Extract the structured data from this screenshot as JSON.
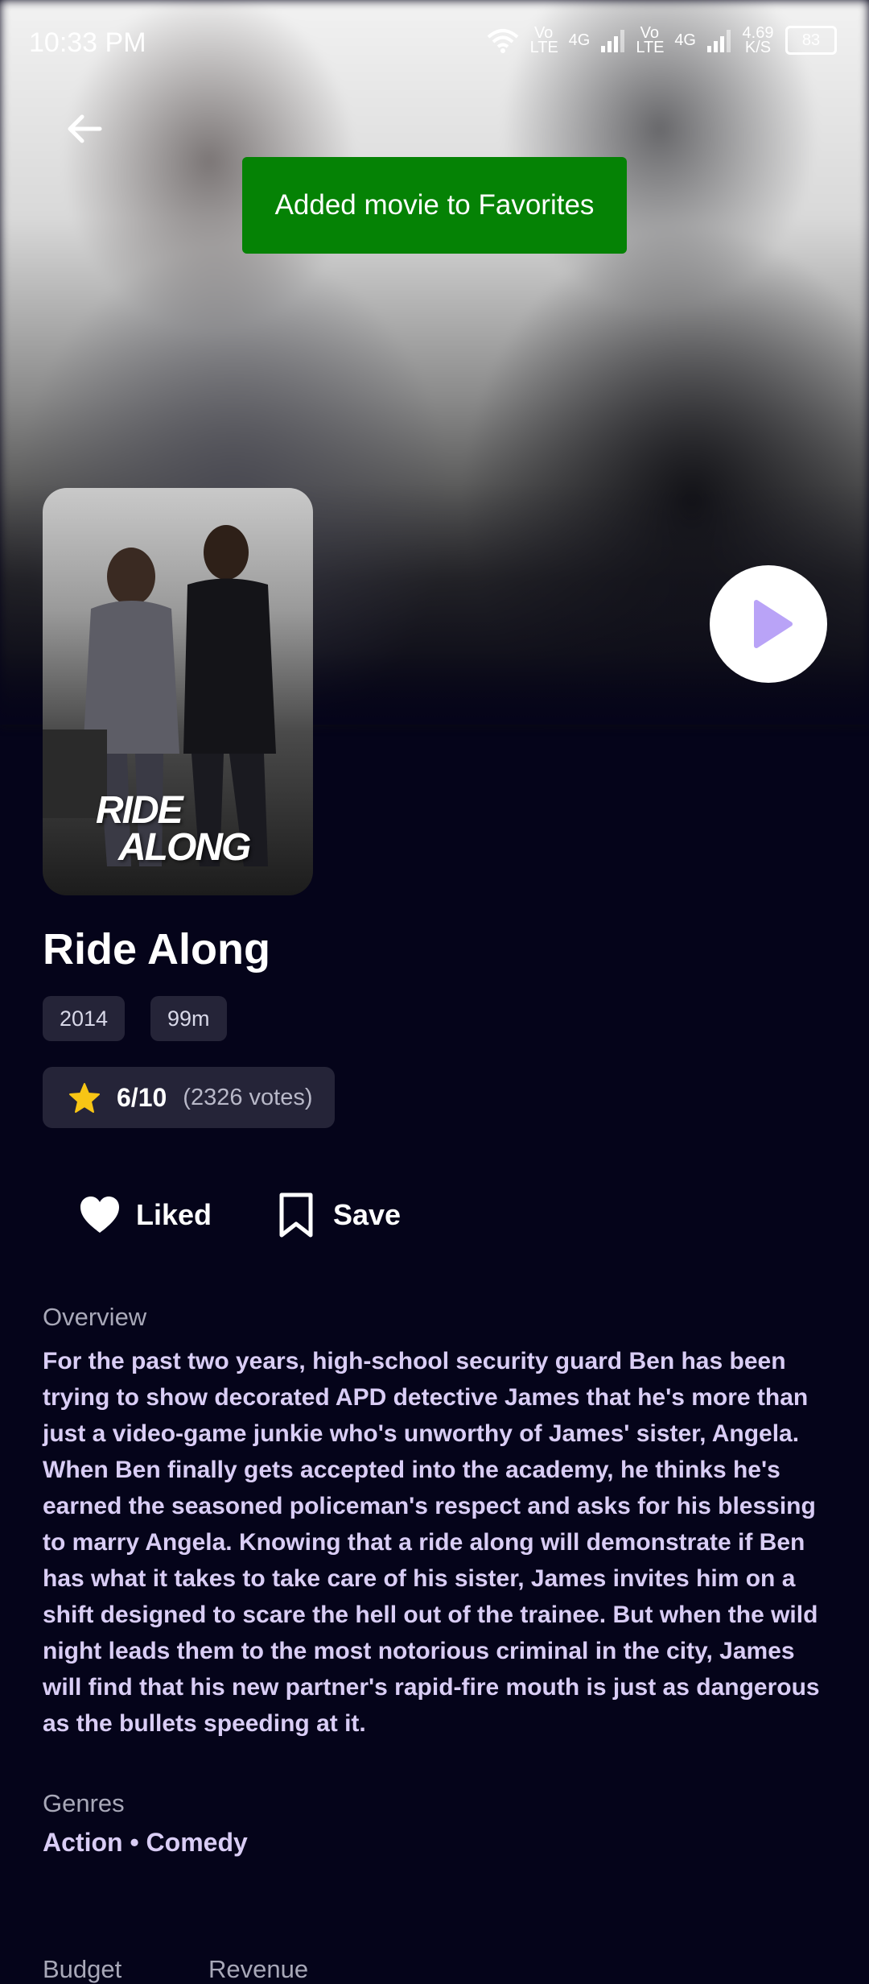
{
  "status_bar": {
    "time": "10:33 PM",
    "net1": "Vo LTE",
    "net1_gen": "4G",
    "net2": "Vo LTE",
    "net2_gen": "4G",
    "speed": "4.69 K/S",
    "battery": "83"
  },
  "toast": {
    "message": "Added movie to Favorites",
    "color": "#058205"
  },
  "movie": {
    "title": "Ride Along",
    "poster_title_line1": "RIDE",
    "poster_title_line2": "ALONG",
    "year": "2014",
    "runtime": "99m",
    "rating": "6/10",
    "votes": "(2326 votes)"
  },
  "actions": {
    "liked_label": "Liked",
    "save_label": "Save"
  },
  "overview": {
    "label": "Overview",
    "text": "For the past two years, high-school security guard Ben has been trying to show decorated APD detective James that he's more than just a video-game junkie who's unworthy of James' sister, Angela. When Ben finally gets accepted into the academy, he thinks he's earned the seasoned policeman's respect and asks for his blessing to marry Angela. Knowing that a ride along will demonstrate if Ben has what it takes to take care of his sister, James invites him on a shift designed to scare the hell out of the trainee. But when the wild night leads them to the most notorious criminal in the city, James will find that his new partner's rapid-fire mouth is just as dangerous as the bullets speeding at it."
  },
  "genres": {
    "label": "Genres",
    "value": "Action • Comedy"
  },
  "financials": {
    "budget_label": "Budget",
    "revenue_label": "Revenue"
  },
  "icons": {
    "back": "arrow-left-icon",
    "play": "play-icon",
    "liked": "heart-icon",
    "save": "bookmark-icon",
    "rating": "star-icon"
  },
  "colors": {
    "background": "#05041a",
    "chip": "#252438",
    "accent_text": "#d9cdf5",
    "play_triangle": "#b9a3f7",
    "star": "#f7c515"
  }
}
